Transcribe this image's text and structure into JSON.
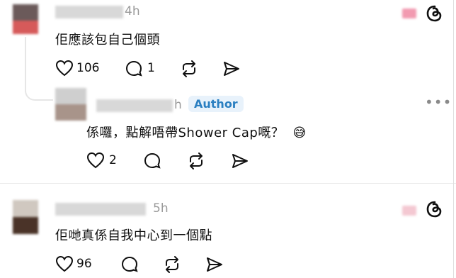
{
  "comment1": {
    "time": "4h",
    "text": "佢應該包自己個頭",
    "like_count": "106",
    "reply_count": "1"
  },
  "reply1": {
    "time": "h",
    "badge": "Author",
    "text": "係囉，點解唔帶Shower Cap嘅？",
    "emoji": "😅",
    "like_count": "2"
  },
  "comment2": {
    "time": "5h",
    "text": "佢哋真係自我中心到一個點",
    "like_count": "96"
  },
  "icons": {
    "heart": "heart-icon",
    "comment": "comment-icon",
    "repost": "repost-icon",
    "share": "share-icon",
    "threads": "threads-logo-icon",
    "more": "more-icon"
  },
  "colors": {
    "accent": "#2a7fc1",
    "badge_bg": "#e8f2fb",
    "text": "#101010",
    "muted": "#999999"
  }
}
